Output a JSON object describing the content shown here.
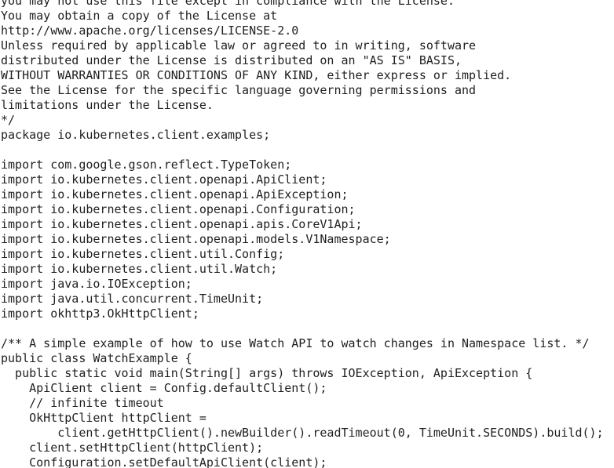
{
  "code_lines": [
    "you may not use this file except in compliance with the License.",
    "You may obtain a copy of the License at",
    "http://www.apache.org/licenses/LICENSE-2.0",
    "Unless required by applicable law or agreed to in writing, software",
    "distributed under the License is distributed on an \"AS IS\" BASIS,",
    "WITHOUT WARRANTIES OR CONDITIONS OF ANY KIND, either express or implied.",
    "See the License for the specific language governing permissions and",
    "limitations under the License.",
    "*/",
    "package io.kubernetes.client.examples;",
    "",
    "import com.google.gson.reflect.TypeToken;",
    "import io.kubernetes.client.openapi.ApiClient;",
    "import io.kubernetes.client.openapi.ApiException;",
    "import io.kubernetes.client.openapi.Configuration;",
    "import io.kubernetes.client.openapi.apis.CoreV1Api;",
    "import io.kubernetes.client.openapi.models.V1Namespace;",
    "import io.kubernetes.client.util.Config;",
    "import io.kubernetes.client.util.Watch;",
    "import java.io.IOException;",
    "import java.util.concurrent.TimeUnit;",
    "import okhttp3.OkHttpClient;",
    "",
    "/** A simple example of how to use Watch API to watch changes in Namespace list. */",
    "public class WatchExample {",
    "  public static void main(String[] args) throws IOException, ApiException {",
    "    ApiClient client = Config.defaultClient();",
    "    // infinite timeout",
    "    OkHttpClient httpClient =",
    "        client.getHttpClient().newBuilder().readTimeout(0, TimeUnit.SECONDS).build();",
    "    client.setHttpClient(httpClient);",
    "    Configuration.setDefaultApiClient(client);"
  ]
}
